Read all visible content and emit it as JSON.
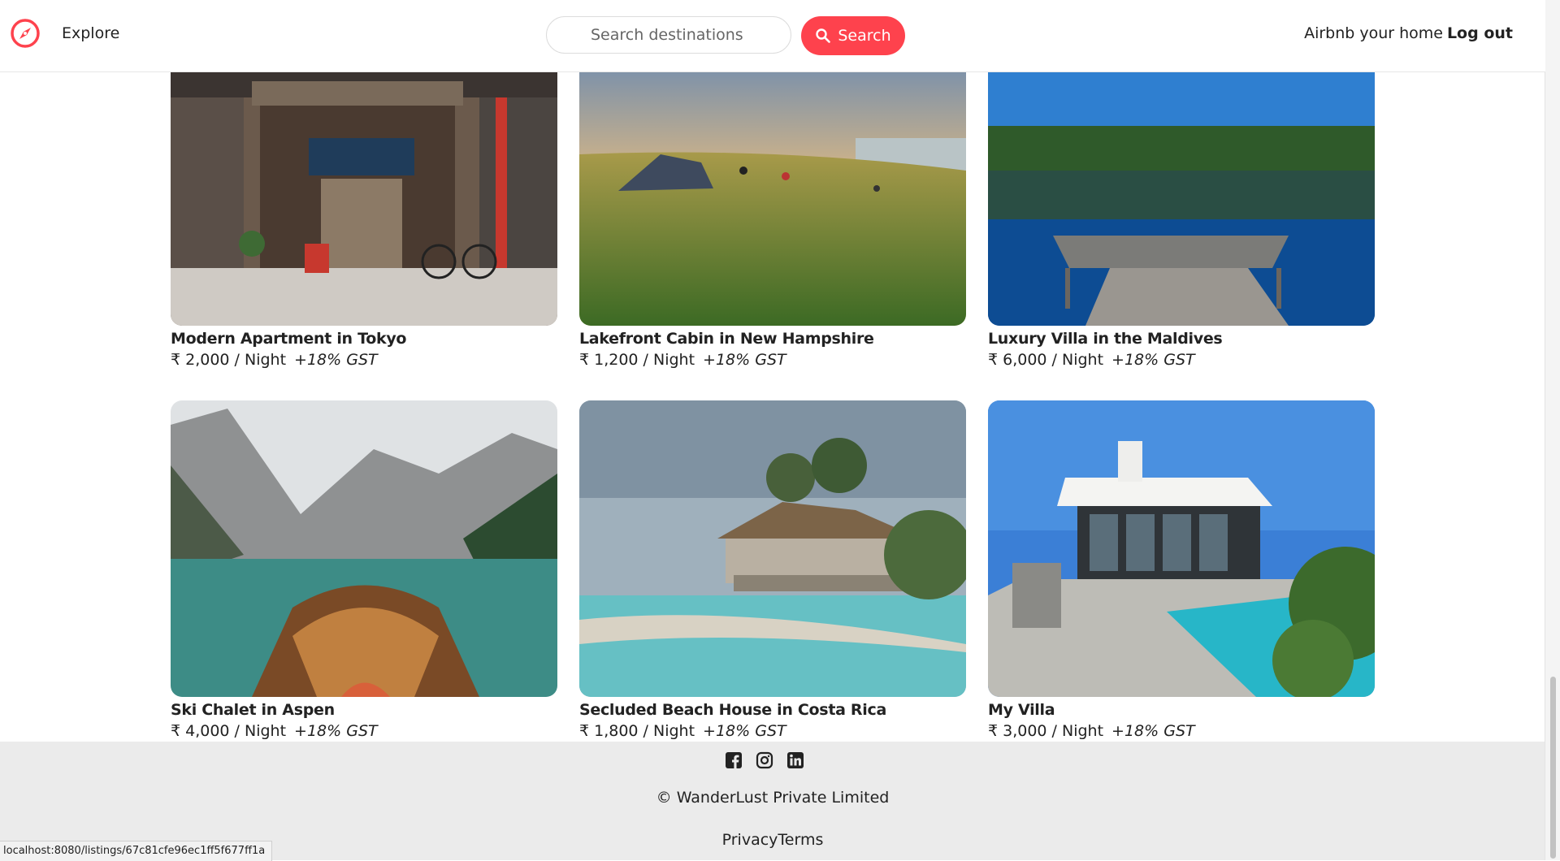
{
  "navbar": {
    "explore_label": "Explore",
    "search_placeholder": "Search destinations",
    "search_button_label": "Search",
    "host_link_label": "Airbnb your home",
    "logout_label": "Log out",
    "brand_color": "#fe424d"
  },
  "listings": [
    {
      "title": "Modern Apartment in Tokyo",
      "price": "₹ 2,000 / Night",
      "gst": "+18% GST",
      "image": "tokyo-street-shop"
    },
    {
      "title": "Lakefront Cabin in New Hampshire",
      "price": "₹ 1,200 / Night",
      "gst": "+18% GST",
      "image": "meadow-tent-sunset"
    },
    {
      "title": "Luxury Villa in the Maldives",
      "price": "₹ 6,000 / Night",
      "gst": "+18% GST",
      "image": "lake-dock"
    },
    {
      "title": "Ski Chalet in Aspen",
      "price": "₹ 4,000 / Night",
      "gst": "+18% GST",
      "image": "mountain-lake-boat"
    },
    {
      "title": "Secluded Beach House in Costa Rica",
      "price": "₹ 1,800 / Night",
      "gst": "+18% GST",
      "image": "beach-hut"
    },
    {
      "title": "My Villa",
      "price": "₹ 3,000 / Night",
      "gst": "+18% GST",
      "image": "modern-villa-pool"
    }
  ],
  "footer": {
    "social_icons": [
      "facebook-icon",
      "instagram-icon",
      "linkedin-icon"
    ],
    "copyright": "© WanderLust Private Limited",
    "links": "PrivacyTerms"
  },
  "status_bar": {
    "url": "localhost:8080/listings/67c81cfe96ec1ff5f677ff1a"
  }
}
